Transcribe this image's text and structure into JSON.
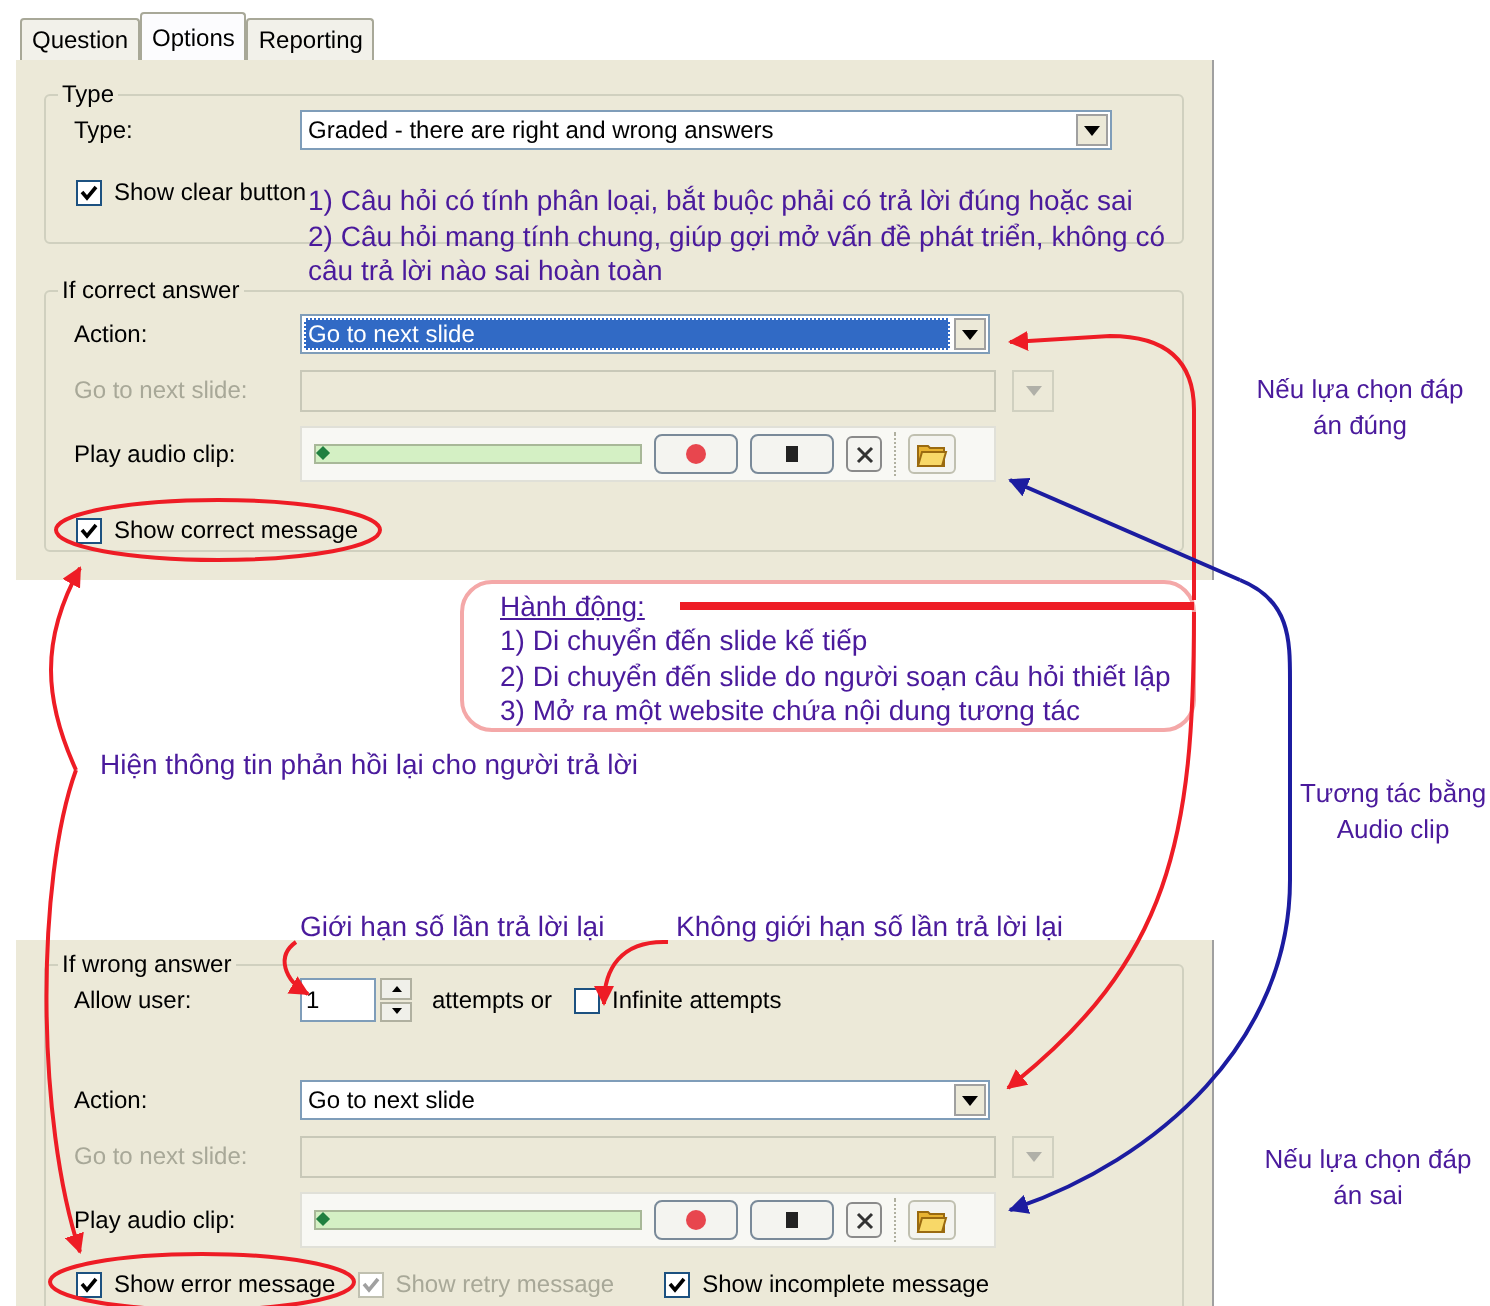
{
  "tabs": [
    {
      "label": "Question",
      "selected": false
    },
    {
      "label": "Options",
      "selected": true
    },
    {
      "label": "Reporting",
      "selected": false
    }
  ],
  "type_group": {
    "legend": "Type",
    "type_label": "Type:",
    "type_value": "Graded - there are right and wrong answers",
    "show_clear_button": {
      "label": "Show clear button",
      "checked": true
    }
  },
  "type_note": [
    "1) Câu hỏi có tính phân loại, bắt buộc phải có trả lời đúng hoặc sai",
    "2) Câu hỏi mang tính chung, giúp gợi mở vấn đề phát triển, không có",
    "câu trả lời nào sai hoàn toàn"
  ],
  "correct_group": {
    "legend": "If correct answer",
    "action_label": "Action:",
    "action_value": "Go to next slide",
    "action_highlighted": true,
    "goto_label": "Go to next slide:",
    "goto_disabled": true,
    "audio_label": "Play audio clip:",
    "message": {
      "label": "Show correct message",
      "checked": true
    }
  },
  "action_note": {
    "title": "Hành động:",
    "lines": [
      "1) Di chuyển đến slide kế tiếp",
      "2) Di chuyển đến slide do người soạn câu hỏi thiết lập",
      "3) Mở ra một website chứa nội dung tương tác"
    ]
  },
  "notes": {
    "feedback": "Hiện thông tin phản hồi lại cho người trả lời",
    "correct_choice": [
      "Nếu lựa chọn đáp",
      "án đúng"
    ],
    "audio": [
      "Tương tác bằng",
      "Audio clip"
    ],
    "limit": "Giới hạn số lần trả lời lại",
    "no_limit": "Không giới hạn số lần trả lời lại",
    "wrong_choice": [
      "Nếu lựa chọn đáp",
      "án sai"
    ]
  },
  "wrong_group": {
    "legend": "If wrong answer",
    "allow_label": "Allow user:",
    "attempts_value": "1",
    "attempts_suffix": "attempts or",
    "infinite": {
      "label": "Infinite attempts",
      "checked": false
    },
    "action_label": "Action:",
    "action_value": "Go to next slide",
    "action_highlighted": false,
    "goto_label": "Go to next slide:",
    "goto_disabled": true,
    "audio_label": "Play audio clip:",
    "messages": [
      {
        "label": "Show error message",
        "checked": true,
        "disabled": false
      },
      {
        "label": "Show retry message",
        "checked": true,
        "disabled": true
      },
      {
        "label": "Show incomplete message",
        "checked": true,
        "disabled": false
      }
    ]
  }
}
